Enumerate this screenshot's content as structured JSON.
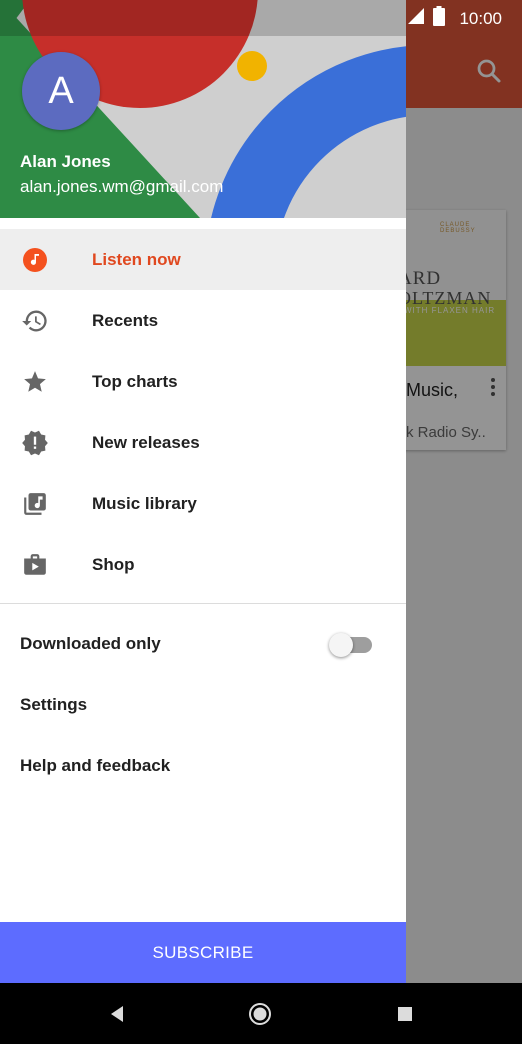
{
  "status_bar": {
    "time": "10:00",
    "icons": [
      "wifi-icon",
      "battery-icon"
    ]
  },
  "drawer": {
    "header": {
      "avatar_letter": "A",
      "user_name": "Alan Jones",
      "user_email": "alan.jones.wm@gmail.com"
    },
    "nav_items": [
      {
        "label": "Listen now",
        "icon": "listen-now-icon",
        "active": true
      },
      {
        "label": "Recents",
        "icon": "history-icon",
        "active": false
      },
      {
        "label": "Top charts",
        "icon": "star-icon",
        "active": false
      },
      {
        "label": "New releases",
        "icon": "new-releases-icon",
        "active": false
      },
      {
        "label": "Music library",
        "icon": "music-library-icon",
        "active": false
      },
      {
        "label": "Shop",
        "icon": "shop-icon",
        "active": false
      }
    ],
    "settings": {
      "downloaded_only": {
        "label": "Downloaded only",
        "enabled": false
      },
      "settings_label": "Settings",
      "help_label": "Help and feedback"
    },
    "subscribe_label": "SUBSCRIBE"
  },
  "background": {
    "card": {
      "cover_line0": "CLAUDE DEBUSSY",
      "cover_line1": "ARD",
      "cover_line2": "OLTZMAN",
      "cover_line3": "WITH FLAXEN HAIR",
      "title": "Music,",
      "subtitle": "k Radio Sy.."
    }
  },
  "colors": {
    "accent": "#e0481f",
    "toolbar": "#e0573a",
    "subscribe": "#5d6cff",
    "avatar": "#5c6bc0"
  }
}
